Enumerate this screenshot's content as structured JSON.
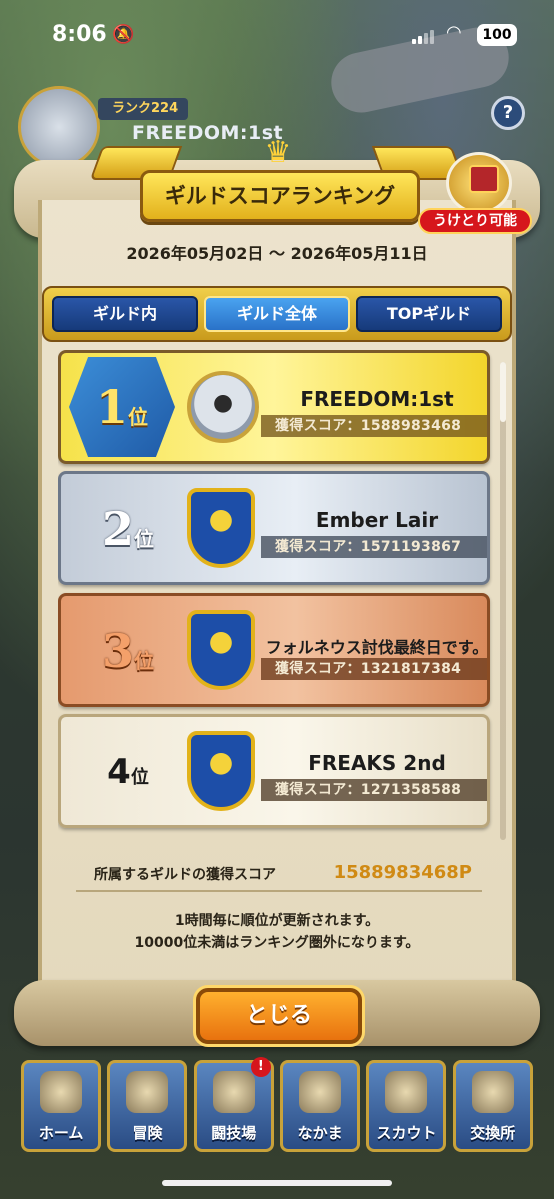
{
  "status_bar": {
    "time": "8:06",
    "battery": "100",
    "bell_icon": "bell-muted-icon",
    "wifi_icon": "wifi-icon"
  },
  "guild_header": {
    "rank_label": "ランク224",
    "guild_name": "FREEDOM:1st",
    "help_label": "?"
  },
  "title": "ギルドスコアランキング",
  "reward_tag": "うけとり可能",
  "date_range": "2026年05月02日 ～ 2026年05月11日",
  "tabs": [
    {
      "label": "ギルド内",
      "active": false
    },
    {
      "label": "ギルド全体",
      "active": true
    },
    {
      "label": "TOPギルド",
      "active": false
    }
  ],
  "ranking": [
    {
      "rank": "1",
      "suffix": "位",
      "name": "FREEDOM:1st",
      "score": "獲得スコア：1588983468"
    },
    {
      "rank": "2",
      "suffix": "位",
      "name": "Ember Lair",
      "score": "獲得スコア：1571193867"
    },
    {
      "rank": "3",
      "suffix": "位",
      "name": "フォルネウス討伐最終日です。",
      "score": "獲得スコア：1321817384"
    },
    {
      "rank": "4",
      "suffix": "位",
      "name": "FREAKS 2nd",
      "score": "獲得スコア：1271358588"
    }
  ],
  "own_score": {
    "label": "所属するギルドの獲得スコア",
    "value": "1588983468P"
  },
  "notes": [
    "1時間毎に順位が更新されます。",
    "10000位未満はランキング圏外になります。"
  ],
  "close_label": "とじる",
  "nav": [
    {
      "label": "ホーム",
      "icon": "home-tent-icon"
    },
    {
      "label": "冒険",
      "icon": "adventure-cart-icon"
    },
    {
      "label": "闘技場",
      "icon": "arena-castle-icon",
      "badge": "!"
    },
    {
      "label": "なかま",
      "icon": "party-monster-icon"
    },
    {
      "label": "スカウト",
      "icon": "scout-portal-icon"
    },
    {
      "label": "交換所",
      "icon": "exchange-monster-icon"
    }
  ],
  "colors": {
    "accent_gold": "#f0cf4a",
    "tab_blue": "#163a7a",
    "score_orange": "#d08a14",
    "close_orange": "#e8720e"
  }
}
